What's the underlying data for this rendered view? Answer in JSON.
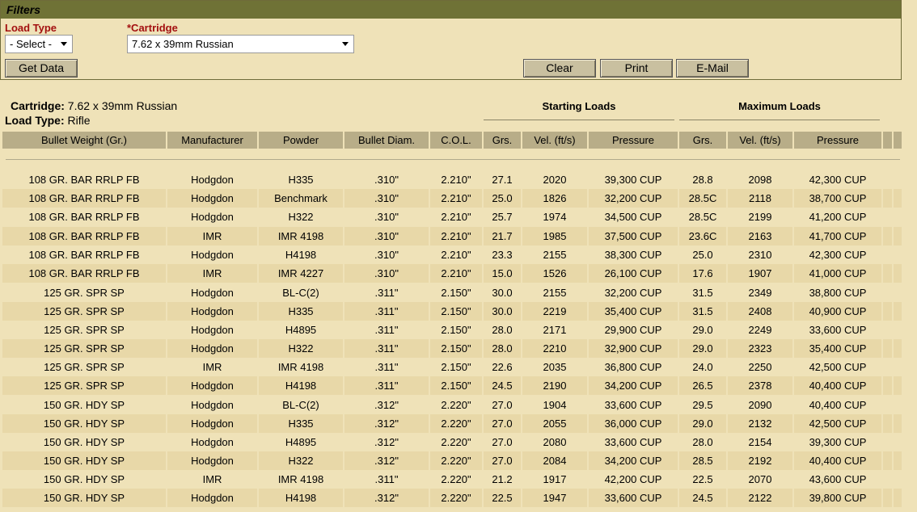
{
  "filters": {
    "title": "Filters",
    "load_type_label": "Load Type",
    "load_type_value": "- Select -",
    "cartridge_label": "*Cartridge",
    "cartridge_value": "7.62 x 39mm Russian",
    "get_data_label": "Get Data",
    "clear_label": "Clear",
    "print_label": "Print",
    "email_label": "E-Mail"
  },
  "summary": {
    "cartridge_label": "Cartridge:",
    "cartridge_value": "7.62 x 39mm Russian",
    "load_type_label": "Load Type:",
    "load_type_value": "Rifle",
    "starting_loads": "Starting Loads",
    "maximum_loads": "Maximum Loads"
  },
  "table": {
    "headers": [
      "Bullet Weight (Gr.)",
      "Manufacturer",
      "Powder",
      "Bullet Diam.",
      "C.O.L.",
      "Grs.",
      "Vel. (ft/s)",
      "Pressure",
      "Grs.",
      "Vel. (ft/s)",
      "Pressure"
    ],
    "rows": [
      [
        "108 GR. BAR RRLP FB",
        "Hodgdon",
        "H335",
        ".310\"",
        "2.210\"",
        "27.1",
        "2020",
        "39,300 CUP",
        "28.8",
        "2098",
        "42,300 CUP"
      ],
      [
        "108 GR. BAR RRLP FB",
        "Hodgdon",
        "Benchmark",
        ".310\"",
        "2.210\"",
        "25.0",
        "1826",
        "32,200 CUP",
        "28.5C",
        "2118",
        "38,700 CUP"
      ],
      [
        "108 GR. BAR RRLP FB",
        "Hodgdon",
        "H322",
        ".310\"",
        "2.210\"",
        "25.7",
        "1974",
        "34,500 CUP",
        "28.5C",
        "2199",
        "41,200 CUP"
      ],
      [
        "108 GR. BAR RRLP FB",
        "IMR",
        "IMR 4198",
        ".310\"",
        "2.210\"",
        "21.7",
        "1985",
        "37,500 CUP",
        "23.6C",
        "2163",
        "41,700 CUP"
      ],
      [
        "108 GR. BAR RRLP FB",
        "Hodgdon",
        "H4198",
        ".310\"",
        "2.210\"",
        "23.3",
        "2155",
        "38,300 CUP",
        "25.0",
        "2310",
        "42,300 CUP"
      ],
      [
        "108 GR. BAR RRLP FB",
        "IMR",
        "IMR 4227",
        ".310\"",
        "2.210\"",
        "15.0",
        "1526",
        "26,100 CUP",
        "17.6",
        "1907",
        "41,000 CUP"
      ],
      [
        "125 GR. SPR SP",
        "Hodgdon",
        "BL-C(2)",
        ".311\"",
        "2.150\"",
        "30.0",
        "2155",
        "32,200 CUP",
        "31.5",
        "2349",
        "38,800 CUP"
      ],
      [
        "125 GR. SPR SP",
        "Hodgdon",
        "H335",
        ".311\"",
        "2.150\"",
        "30.0",
        "2219",
        "35,400 CUP",
        "31.5",
        "2408",
        "40,900 CUP"
      ],
      [
        "125 GR. SPR SP",
        "Hodgdon",
        "H4895",
        ".311\"",
        "2.150\"",
        "28.0",
        "2171",
        "29,900 CUP",
        "29.0",
        "2249",
        "33,600 CUP"
      ],
      [
        "125 GR. SPR SP",
        "Hodgdon",
        "H322",
        ".311\"",
        "2.150\"",
        "28.0",
        "2210",
        "32,900 CUP",
        "29.0",
        "2323",
        "35,400 CUP"
      ],
      [
        "125 GR. SPR SP",
        "IMR",
        "IMR 4198",
        ".311\"",
        "2.150\"",
        "22.6",
        "2035",
        "36,800 CUP",
        "24.0",
        "2250",
        "42,500 CUP"
      ],
      [
        "125 GR. SPR SP",
        "Hodgdon",
        "H4198",
        ".311\"",
        "2.150\"",
        "24.5",
        "2190",
        "34,200 CUP",
        "26.5",
        "2378",
        "40,400 CUP"
      ],
      [
        "150 GR. HDY SP",
        "Hodgdon",
        "BL-C(2)",
        ".312\"",
        "2.220\"",
        "27.0",
        "1904",
        "33,600 CUP",
        "29.5",
        "2090",
        "40,400 CUP"
      ],
      [
        "150 GR. HDY SP",
        "Hodgdon",
        "H335",
        ".312\"",
        "2.220\"",
        "27.0",
        "2055",
        "36,000 CUP",
        "29.0",
        "2132",
        "42,500 CUP"
      ],
      [
        "150 GR. HDY SP",
        "Hodgdon",
        "H4895",
        ".312\"",
        "2.220\"",
        "27.0",
        "2080",
        "33,600 CUP",
        "28.0",
        "2154",
        "39,300 CUP"
      ],
      [
        "150 GR. HDY SP",
        "Hodgdon",
        "H322",
        ".312\"",
        "2.220\"",
        "27.0",
        "2084",
        "34,200 CUP",
        "28.5",
        "2192",
        "40,400 CUP"
      ],
      [
        "150 GR. HDY SP",
        "IMR",
        "IMR 4198",
        ".311\"",
        "2.220\"",
        "21.2",
        "1917",
        "42,200 CUP",
        "22.5",
        "2070",
        "43,600 CUP"
      ],
      [
        "150 GR. HDY SP",
        "Hodgdon",
        "H4198",
        ".312\"",
        "2.220\"",
        "22.5",
        "1947",
        "33,600 CUP",
        "24.5",
        "2122",
        "39,800 CUP"
      ]
    ]
  }
}
